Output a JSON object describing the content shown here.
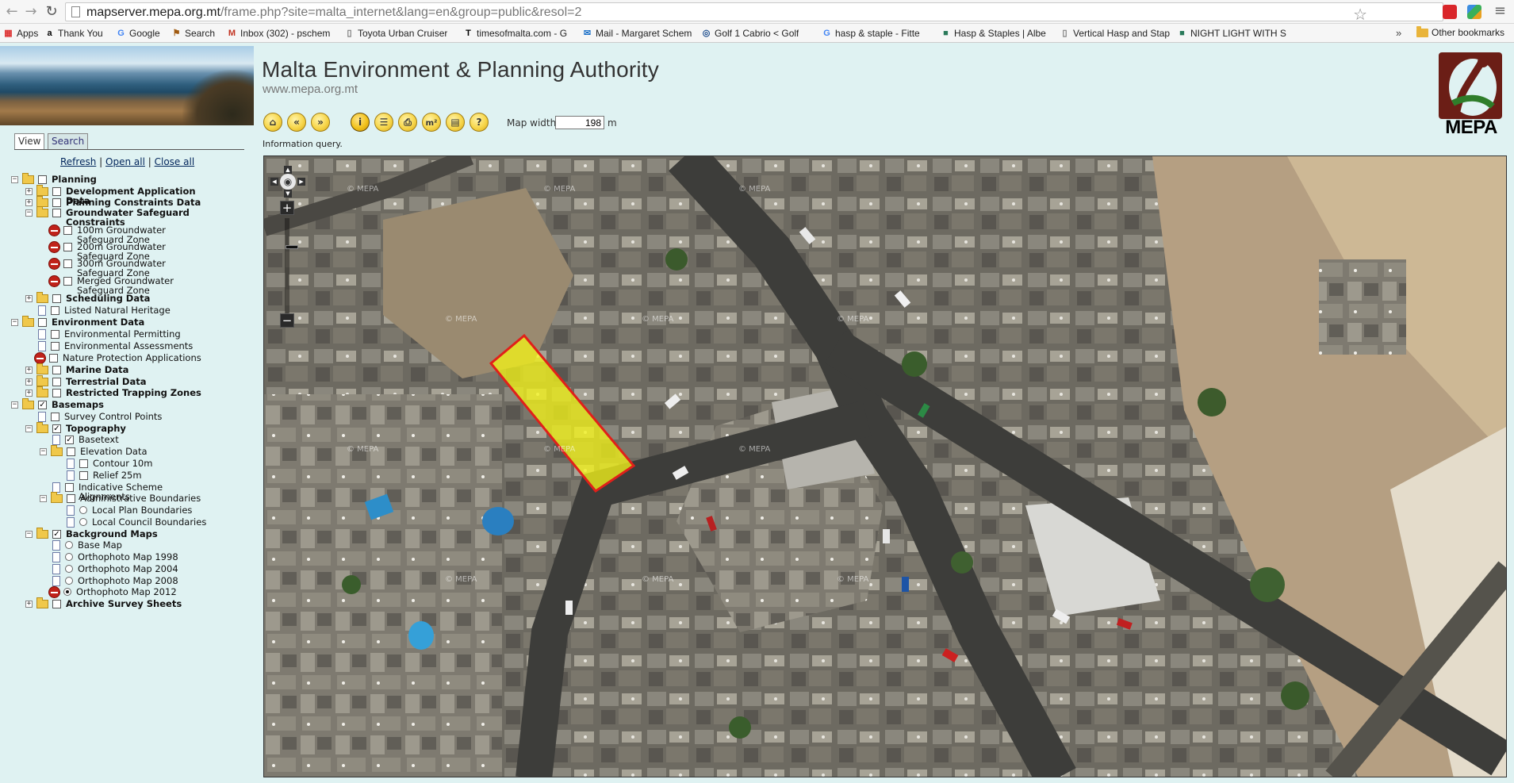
{
  "browser": {
    "url_host": "mapserver.mepa.org.mt",
    "url_path": "/frame.php?site=malta_internet&lang=en&group=public&resol=2",
    "bookmarks": [
      {
        "label": "Apps",
        "icon": "apps-grid-icon"
      },
      {
        "label": "Thank You",
        "icon": "amazon-icon"
      },
      {
        "label": "Google",
        "icon": "google-icon"
      },
      {
        "label": "Search",
        "icon": "search-site-icon"
      },
      {
        "label": "Inbox (302) - pschem",
        "icon": "gmail-icon"
      },
      {
        "label": "Toyota Urban Cruiser",
        "icon": "page-icon"
      },
      {
        "label": "timesofmalta.com - G",
        "icon": "times-icon"
      },
      {
        "label": "Mail - Margaret Schem",
        "icon": "mail-icon"
      },
      {
        "label": "Golf 1 Cabrio < Golf",
        "icon": "vw-icon"
      },
      {
        "label": "hasp & staple - Fitte",
        "icon": "google-icon"
      },
      {
        "label": "Hasp & Staples | Albe",
        "icon": "site-icon"
      },
      {
        "label": "Vertical Hasp and Stap",
        "icon": "page-icon"
      },
      {
        "label": "NIGHT LIGHT WITH S",
        "icon": "site-icon"
      }
    ],
    "more_label": "»",
    "other_bookmarks": "Other bookmarks"
  },
  "header": {
    "title": "Malta Environment & Planning Authority",
    "subtitle": "www.mepa.org.mt",
    "logo_text": "MEPA"
  },
  "toolbar": {
    "tools": [
      {
        "name": "home-tool",
        "icon": "home-icon",
        "glyph": "⌂"
      },
      {
        "name": "back-tool",
        "icon": "rewind-icon",
        "glyph": "«"
      },
      {
        "name": "forward-tool",
        "icon": "fast-forward-icon",
        "glyph": "»"
      },
      {
        "name": "info-tool",
        "icon": "info-icon",
        "glyph": "i",
        "active": true
      },
      {
        "name": "legend-tool",
        "icon": "list-icon",
        "glyph": "☰"
      },
      {
        "name": "print-tool",
        "icon": "print-icon",
        "glyph": "⎙"
      },
      {
        "name": "area-tool",
        "icon": "area-measure-icon",
        "glyph": "m²"
      },
      {
        "name": "query-tool",
        "icon": "query-icon",
        "glyph": "▤"
      },
      {
        "name": "help-tool",
        "icon": "help-icon",
        "glyph": "?"
      }
    ],
    "map_width_label": "Map width",
    "map_width_value": "198",
    "map_width_unit": "m",
    "status": "Information query."
  },
  "panel": {
    "tabs": [
      "View",
      "Search"
    ],
    "actions": {
      "refresh": "Refresh",
      "open_all": "Open all",
      "close_all": "Close all",
      "sep": "|"
    },
    "tree": [
      {
        "label": "Planning",
        "depth": 0,
        "expander": "minus",
        "icon": "folder",
        "control": "checkbox",
        "checked": false,
        "bold": true
      },
      {
        "label": "Development Application Data",
        "depth": 1,
        "expander": "plus",
        "icon": "folder",
        "control": "checkbox",
        "checked": false,
        "bold": true
      },
      {
        "label": "Planning Constraints Data",
        "depth": 1,
        "expander": "plus",
        "icon": "folder",
        "control": "checkbox",
        "checked": false,
        "bold": true
      },
      {
        "label": "Groundwater Safeguard Constraints",
        "depth": 1,
        "expander": "minus",
        "icon": "folder",
        "control": "checkbox",
        "checked": false,
        "bold": true
      },
      {
        "label": "100m Groundwater Safeguard Zone",
        "depth": 2,
        "expander": "none",
        "icon": "noentry",
        "control": "checkbox",
        "checked": false,
        "bold": false
      },
      {
        "label": "200m Groundwater Safeguard Zone",
        "depth": 2,
        "expander": "none",
        "icon": "noentry",
        "control": "checkbox",
        "checked": false,
        "bold": false
      },
      {
        "label": "300m Groundwater Safeguard Zone",
        "depth": 2,
        "expander": "none",
        "icon": "noentry",
        "control": "checkbox",
        "checked": false,
        "bold": false
      },
      {
        "label": "Merged Groundwater Safeguard Zone",
        "depth": 2,
        "expander": "none",
        "icon": "noentry",
        "control": "checkbox",
        "checked": false,
        "bold": false
      },
      {
        "label": "Scheduling Data",
        "depth": 1,
        "expander": "plus",
        "icon": "folder",
        "control": "checkbox",
        "checked": false,
        "bold": true
      },
      {
        "label": "Listed Natural Heritage",
        "depth": 1,
        "expander": "none",
        "icon": "doc",
        "control": "checkbox",
        "checked": false,
        "bold": false
      },
      {
        "label": "Environment Data",
        "depth": 0,
        "expander": "minus",
        "icon": "folder",
        "control": "checkbox",
        "checked": false,
        "bold": true
      },
      {
        "label": "Environmental Permitting",
        "depth": 1,
        "expander": "none",
        "icon": "doc",
        "control": "checkbox",
        "checked": false,
        "bold": false
      },
      {
        "label": "Environmental Assessments",
        "depth": 1,
        "expander": "none",
        "icon": "doc",
        "control": "checkbox",
        "checked": false,
        "bold": false
      },
      {
        "label": "Nature Protection Applications",
        "depth": 1,
        "expander": "none",
        "icon": "noentry",
        "control": "checkbox",
        "checked": false,
        "bold": false
      },
      {
        "label": "Marine Data",
        "depth": 1,
        "expander": "plus",
        "icon": "folder",
        "control": "checkbox",
        "checked": false,
        "bold": true
      },
      {
        "label": "Terrestrial Data",
        "depth": 1,
        "expander": "plus",
        "icon": "folder",
        "control": "checkbox",
        "checked": false,
        "bold": true
      },
      {
        "label": "Restricted Trapping Zones",
        "depth": 1,
        "expander": "plus",
        "icon": "folder",
        "control": "checkbox",
        "checked": false,
        "bold": true
      },
      {
        "label": "Basemaps",
        "depth": 0,
        "expander": "minus",
        "icon": "folder",
        "control": "checkbox",
        "checked": true,
        "bold": true
      },
      {
        "label": "Survey Control Points",
        "depth": 1,
        "expander": "none",
        "icon": "doc",
        "control": "checkbox",
        "checked": false,
        "bold": false
      },
      {
        "label": "Topography",
        "depth": 1,
        "expander": "minus",
        "icon": "folder",
        "control": "checkbox",
        "checked": true,
        "bold": true
      },
      {
        "label": "Basetext",
        "depth": 2,
        "expander": "none",
        "icon": "doc",
        "control": "checkbox",
        "checked": true,
        "bold": false
      },
      {
        "label": "Elevation Data",
        "depth": 2,
        "expander": "minus",
        "icon": "folder",
        "control": "checkbox",
        "checked": false,
        "bold": false
      },
      {
        "label": "Contour 10m",
        "depth": 3,
        "expander": "none",
        "icon": "doc",
        "control": "checkbox",
        "checked": false,
        "bold": false
      },
      {
        "label": "Relief 25m",
        "depth": 3,
        "expander": "none",
        "icon": "doc",
        "control": "checkbox",
        "checked": false,
        "bold": false
      },
      {
        "label": "Indicative Scheme Alignments",
        "depth": 2,
        "expander": "none",
        "icon": "doc",
        "control": "checkbox",
        "checked": false,
        "bold": false
      },
      {
        "label": "Administrative Boundaries",
        "depth": 2,
        "expander": "minus",
        "icon": "folder",
        "control": "checkbox",
        "checked": false,
        "bold": false
      },
      {
        "label": "Local Plan Boundaries",
        "depth": 3,
        "expander": "none",
        "icon": "doc",
        "control": "radio",
        "checked": false,
        "bold": false
      },
      {
        "label": "Local Council Boundaries",
        "depth": 3,
        "expander": "none",
        "icon": "doc",
        "control": "radio",
        "checked": false,
        "bold": false
      },
      {
        "label": "Background Maps",
        "depth": 1,
        "expander": "minus",
        "icon": "folder",
        "control": "checkbox",
        "checked": true,
        "bold": true
      },
      {
        "label": "Base Map",
        "depth": 2,
        "expander": "none",
        "icon": "doc",
        "control": "radio",
        "checked": false,
        "bold": false
      },
      {
        "label": "Orthophoto Map 1998",
        "depth": 2,
        "expander": "none",
        "icon": "doc",
        "control": "radio",
        "checked": false,
        "bold": false
      },
      {
        "label": "Orthophoto Map 2004",
        "depth": 2,
        "expander": "none",
        "icon": "doc",
        "control": "radio",
        "checked": false,
        "bold": false
      },
      {
        "label": "Orthophoto Map 2008",
        "depth": 2,
        "expander": "none",
        "icon": "doc",
        "control": "radio",
        "checked": false,
        "bold": false
      },
      {
        "label": "Orthophoto Map 2012",
        "depth": 2,
        "expander": "none",
        "icon": "noentry",
        "control": "radio",
        "checked": true,
        "bold": false
      },
      {
        "label": "Archive Survey Sheets",
        "depth": 1,
        "expander": "plus",
        "icon": "folder",
        "control": "checkbox",
        "checked": false,
        "bold": true
      }
    ]
  },
  "map": {
    "watermark": "© MEPA",
    "highlight_fill": "#f2f21a",
    "highlight_stroke": "#e0201a"
  }
}
